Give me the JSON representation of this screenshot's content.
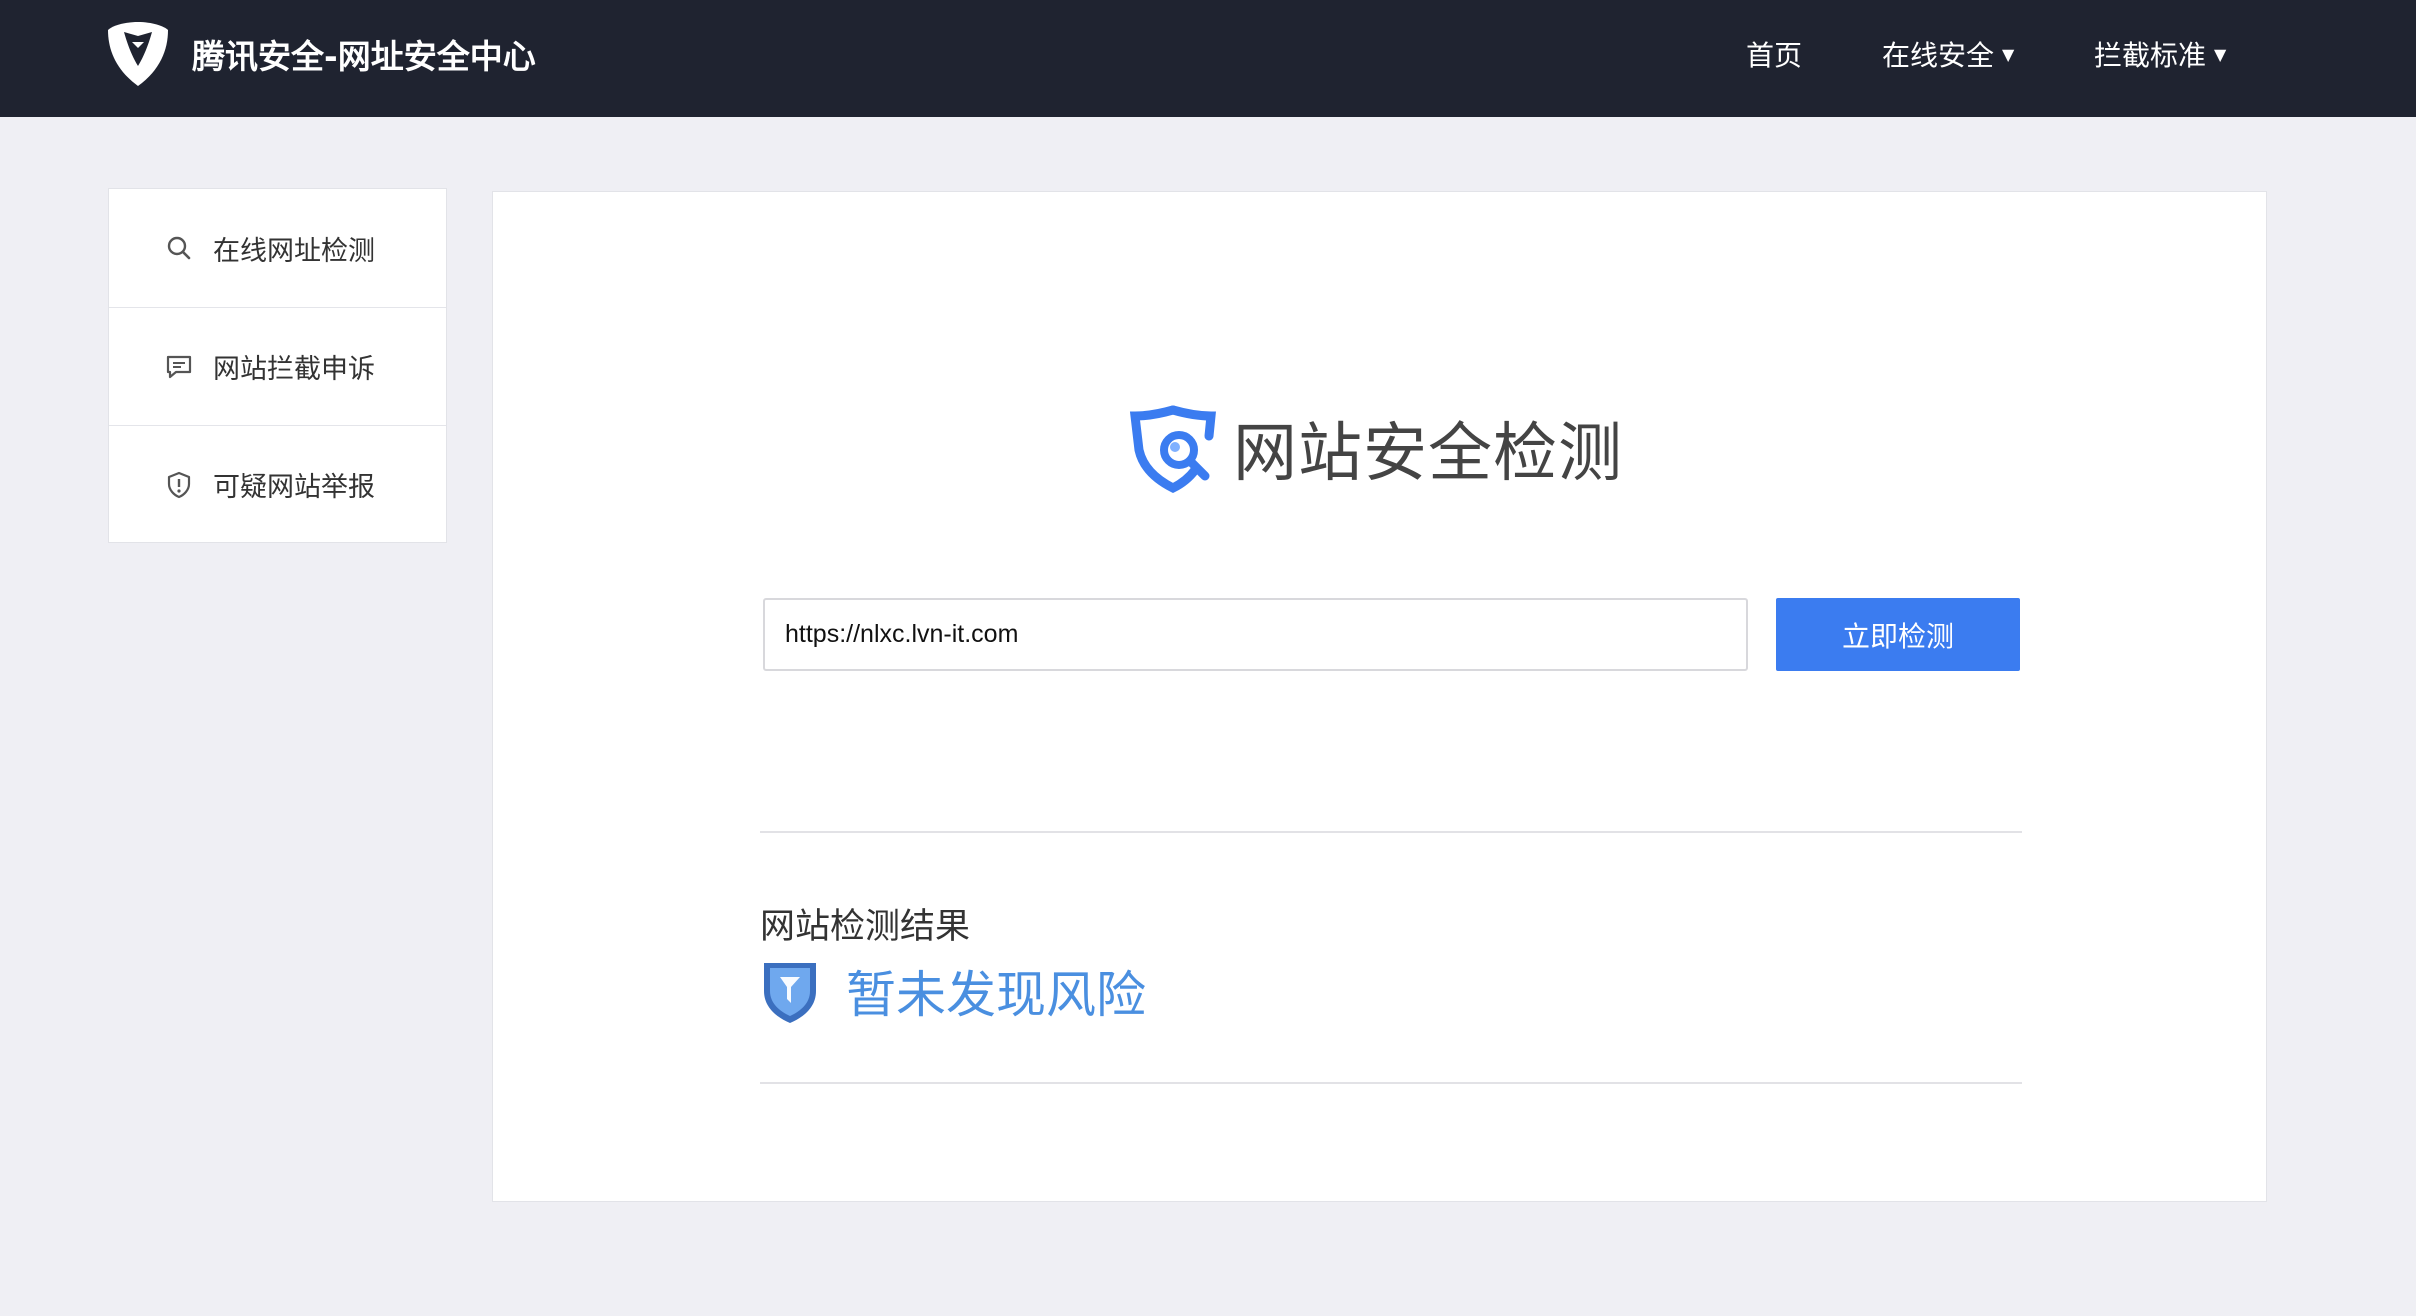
{
  "header": {
    "brand_title": "腾讯安全-网址安全中心",
    "logo_icon": "tencent-security-logo",
    "nav": [
      {
        "label": "首页",
        "has_dropdown": false
      },
      {
        "label": "在线安全",
        "has_dropdown": true
      },
      {
        "label": "拦截标准",
        "has_dropdown": true
      }
    ]
  },
  "sidebar": {
    "items": [
      {
        "label": "在线网址检测",
        "icon": "search-icon"
      },
      {
        "label": "网站拦截申诉",
        "icon": "chat-icon"
      },
      {
        "label": "可疑网站举报",
        "icon": "shield-alert-icon"
      }
    ]
  },
  "main": {
    "title": "网站安全检测",
    "url_value": "https://nlxc.lvn-it.com",
    "check_button": "立即检测",
    "result_heading": "网站检测结果",
    "result_text": "暂未发现风险"
  },
  "colors": {
    "header_bg": "#1f2330",
    "page_bg": "#efeff4",
    "accent": "#3b7cf0",
    "result_blue": "#4a8fe0"
  }
}
